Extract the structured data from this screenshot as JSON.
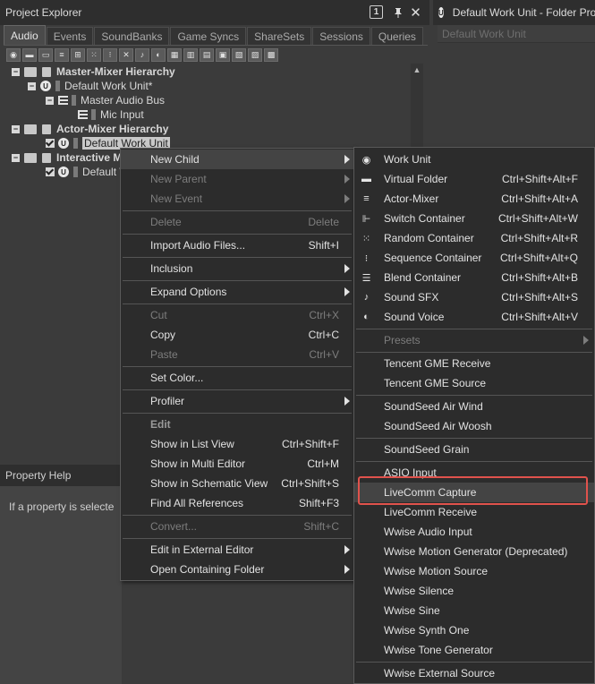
{
  "project_explorer": {
    "title": "Project Explorer",
    "help_label": "1",
    "tabs": [
      "Audio",
      "Events",
      "SoundBanks",
      "Game Syncs",
      "ShareSets",
      "Sessions",
      "Queries"
    ],
    "tree": {
      "master_mixer": "Master-Mixer Hierarchy",
      "default_wu_star": "Default Work Unit*",
      "master_audio_bus": "Master Audio Bus",
      "mic_input": "Mic Input",
      "actor_mixer": "Actor-Mixer Hierarchy",
      "default_wu": "Default Work Unit",
      "interactive": "Interactive M",
      "default_w": "Default W"
    }
  },
  "folder_panel": {
    "title": "Default Work Unit - Folder Prop",
    "field": "Default Work Unit"
  },
  "property_help": {
    "title": "Property Help",
    "body": "If a property is selecte"
  },
  "context_menu": [
    {
      "label": "New Child",
      "arrow": true,
      "state": "highlight"
    },
    {
      "label": "New Parent",
      "arrow": true,
      "state": "disabled"
    },
    {
      "label": "New Event",
      "arrow": true,
      "state": "disabled"
    },
    {
      "label": "Delete",
      "shortcut": "Delete",
      "state": "disabled"
    },
    {
      "label": "Import Audio Files...",
      "shortcut": "Shift+I"
    },
    {
      "label": "Inclusion",
      "arrow": true
    },
    {
      "label": "Expand Options",
      "arrow": true
    },
    {
      "label": "Cut",
      "shortcut": "Ctrl+X",
      "state": "disabled"
    },
    {
      "label": "Copy",
      "shortcut": "Ctrl+C"
    },
    {
      "label": "Paste",
      "shortcut": "Ctrl+V",
      "state": "disabled"
    },
    {
      "label": "Set Color..."
    },
    {
      "label": "Profiler",
      "arrow": true
    },
    {
      "label": "Edit",
      "state": "header"
    },
    {
      "label": "Show in List View",
      "shortcut": "Ctrl+Shift+F"
    },
    {
      "label": "Show in Multi Editor",
      "shortcut": "Ctrl+M"
    },
    {
      "label": "Show in Schematic View",
      "shortcut": "Ctrl+Shift+S"
    },
    {
      "label": "Find All References",
      "shortcut": "Shift+F3"
    },
    {
      "label": "Convert...",
      "shortcut": "Shift+C",
      "state": "disabled"
    },
    {
      "label": "Edit in External Editor",
      "arrow": true
    },
    {
      "label": "Open Containing Folder",
      "arrow": true
    }
  ],
  "sub_menu": [
    {
      "label": "Work Unit",
      "icon": "work-unit-icon"
    },
    {
      "label": "Virtual Folder",
      "shortcut": "Ctrl+Shift+Alt+F",
      "icon": "folder-icon"
    },
    {
      "label": "Actor-Mixer",
      "shortcut": "Ctrl+Shift+Alt+A",
      "icon": "actor-mixer-icon"
    },
    {
      "label": "Switch Container",
      "shortcut": "Ctrl+Shift+Alt+W",
      "icon": "switch-container-icon"
    },
    {
      "label": "Random Container",
      "shortcut": "Ctrl+Shift+Alt+R",
      "icon": "random-container-icon"
    },
    {
      "label": "Sequence Container",
      "shortcut": "Ctrl+Shift+Alt+Q",
      "icon": "sequence-container-icon"
    },
    {
      "label": "Blend Container",
      "shortcut": "Ctrl+Shift+Alt+B",
      "icon": "blend-container-icon"
    },
    {
      "label": "Sound SFX",
      "shortcut": "Ctrl+Shift+Alt+S",
      "icon": "sound-sfx-icon"
    },
    {
      "label": "Sound Voice",
      "shortcut": "Ctrl+Shift+Alt+V",
      "icon": "sound-voice-icon"
    },
    {
      "label": "Presets",
      "arrow": true,
      "state": "disabled"
    },
    {
      "label": "Tencent GME Receive"
    },
    {
      "label": "Tencent GME Source"
    },
    {
      "label": "SoundSeed Air Wind"
    },
    {
      "label": "SoundSeed Air Woosh"
    },
    {
      "label": "SoundSeed Grain"
    },
    {
      "label": "ASIO Input"
    },
    {
      "label": "LiveComm Capture",
      "state": "highlight"
    },
    {
      "label": "LiveComm Receive"
    },
    {
      "label": "Wwise Audio Input"
    },
    {
      "label": "Wwise Motion Generator (Deprecated)"
    },
    {
      "label": "Wwise Motion Source"
    },
    {
      "label": "Wwise Silence"
    },
    {
      "label": "Wwise Sine"
    },
    {
      "label": "Wwise Synth One"
    },
    {
      "label": "Wwise Tone Generator"
    },
    {
      "label": "Wwise External Source"
    }
  ],
  "colors": {
    "highlight_box": "#e0524c",
    "menu_bg": "#2c2c2c",
    "menu_highlight": "#444444"
  }
}
